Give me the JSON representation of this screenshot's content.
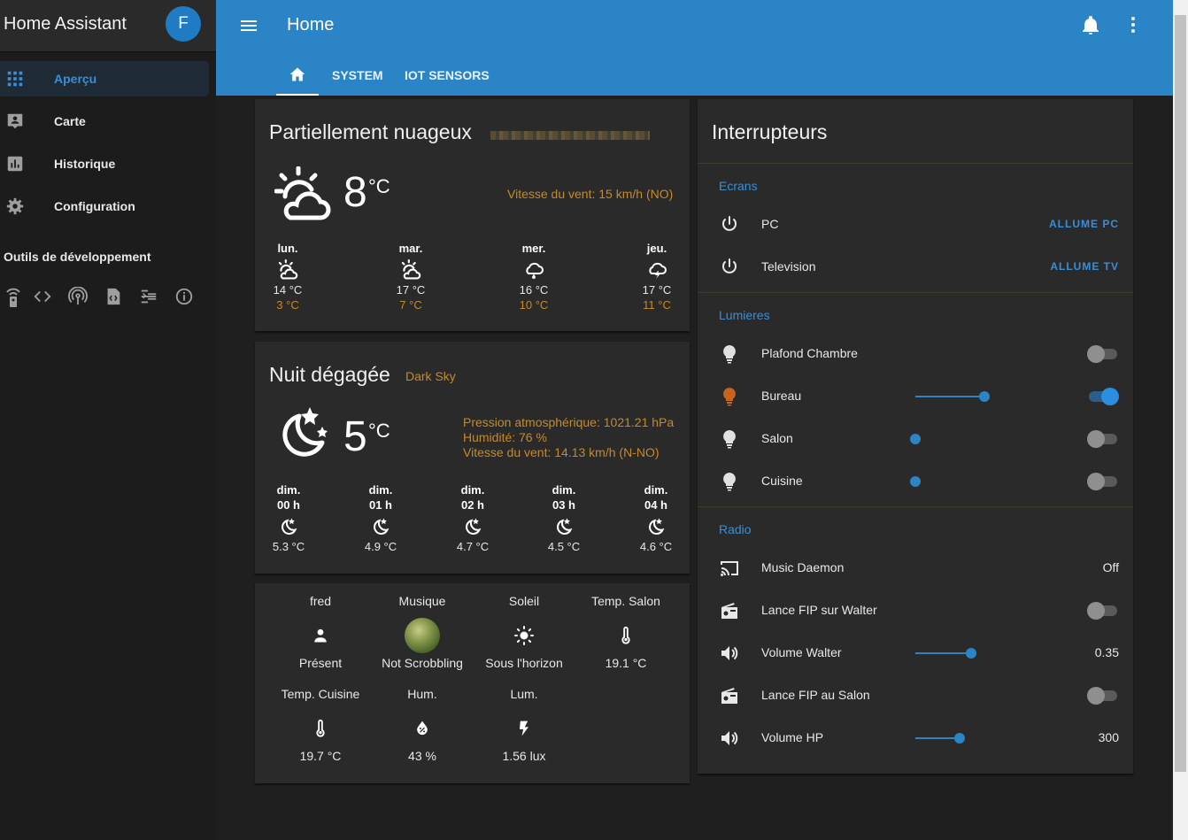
{
  "sidebar": {
    "title": "Home Assistant",
    "avatar_letter": "F",
    "items": [
      {
        "label": "Aperçu",
        "icon": "grid-icon"
      },
      {
        "label": "Carte",
        "icon": "map-account-icon"
      },
      {
        "label": "Historique",
        "icon": "chart-bar-icon"
      },
      {
        "label": "Configuration",
        "icon": "gear-icon"
      }
    ],
    "dev_tools_title": "Outils de développement",
    "dev_tools_icons": [
      "remote-icon",
      "code-icon",
      "antenna-icon",
      "file-code-icon",
      "template-icon",
      "info-icon"
    ]
  },
  "header": {
    "title": "Home",
    "tabs": [
      {
        "label": "",
        "icon": "home-icon"
      },
      {
        "label": "SYSTEM"
      },
      {
        "label": "IOT SENSORS"
      }
    ]
  },
  "weather1": {
    "condition": "Partiellement nuageux",
    "temp": "8",
    "unit": "°C",
    "wind": "Vitesse du vent: 15 km/h (NO)",
    "forecast": [
      {
        "day": "lun.",
        "hi": "14 °C",
        "lo": "3 °C",
        "icon": "partly-cloudy-icon"
      },
      {
        "day": "mar.",
        "hi": "17 °C",
        "lo": "7 °C",
        "icon": "partly-cloudy-icon"
      },
      {
        "day": "mer.",
        "hi": "16 °C",
        "lo": "10 °C",
        "icon": "rain-icon"
      },
      {
        "day": "jeu.",
        "hi": "17 °C",
        "lo": "11 °C",
        "icon": "lightning-rainy-icon"
      }
    ]
  },
  "weather2": {
    "condition": "Nuit dégagée",
    "source": "Dark Sky",
    "temp": "5",
    "unit": "°C",
    "pressure": "Pression atmosphérique: 1021.21 hPa",
    "humidity": "Humidité: 76 %",
    "wind": "Vitesse du vent: 14.13 km/h (N-NO)",
    "forecast": [
      {
        "day": "dim.",
        "hour": "00 h",
        "temp": "5.3 °C",
        "icon": "night-icon"
      },
      {
        "day": "dim.",
        "hour": "01 h",
        "temp": "4.9 °C",
        "icon": "night-icon"
      },
      {
        "day": "dim.",
        "hour": "02 h",
        "temp": "4.7 °C",
        "icon": "night-icon"
      },
      {
        "day": "dim.",
        "hour": "03 h",
        "temp": "4.5 °C",
        "icon": "night-icon"
      },
      {
        "day": "dim.",
        "hour": "04 h",
        "temp": "4.6 °C",
        "icon": "night-icon"
      }
    ]
  },
  "glance": [
    {
      "name": "fred",
      "state": "Présent",
      "icon": "account-icon"
    },
    {
      "name": "Musique",
      "state": "Not Scrobbling",
      "icon": "album-art-icon"
    },
    {
      "name": "Soleil",
      "state": "Sous l'horizon",
      "icon": "sun-icon"
    },
    {
      "name": "Temp. Salon",
      "state": "19.1 °C",
      "icon": "thermometer-icon"
    },
    {
      "name": "Temp. Cuisine",
      "state": "19.7 °C",
      "icon": "thermometer-icon"
    },
    {
      "name": "Hum.",
      "state": "43 %",
      "icon": "water-percent-icon"
    },
    {
      "name": "Lum.",
      "state": "1.56 lux",
      "icon": "flash-icon"
    }
  ],
  "switches": {
    "title": "Interrupteurs",
    "ecrans": {
      "title": "Ecrans",
      "rows": [
        {
          "name": "PC",
          "action": "ALLUME PC"
        },
        {
          "name": "Television",
          "action": "ALLUME TV"
        }
      ]
    },
    "lumieres": {
      "title": "Lumieres",
      "rows": [
        {
          "name": "Plafond Chambre",
          "on": false,
          "color": "#e1e1e1"
        },
        {
          "name": "Bureau",
          "on": true,
          "color": "#c8641e",
          "brightness": 0.62
        },
        {
          "name": "Salon",
          "on": false,
          "color": "#e1e1e1",
          "brightness": 0
        },
        {
          "name": "Cuisine",
          "on": false,
          "color": "#e1e1e1",
          "brightness": 0
        }
      ]
    },
    "radio": {
      "title": "Radio",
      "rows": [
        {
          "name": "Music Daemon",
          "value": "Off",
          "icon": "cast-icon"
        },
        {
          "name": "Lance FIP sur Walter",
          "on": false,
          "icon": "radio-icon"
        },
        {
          "name": "Volume Walter",
          "value": "0.35",
          "icon": "volume-icon",
          "level": 0.5
        },
        {
          "name": "Lance FIP au Salon",
          "on": false,
          "icon": "radio-icon"
        },
        {
          "name": "Volume HP",
          "value": "300",
          "icon": "volume-icon",
          "level": 0.4
        }
      ]
    }
  },
  "colors": {
    "primary": "#2b84c6",
    "accent": "#c48a2c",
    "background": "#1f1f1f",
    "card": "#2a2a2a"
  }
}
